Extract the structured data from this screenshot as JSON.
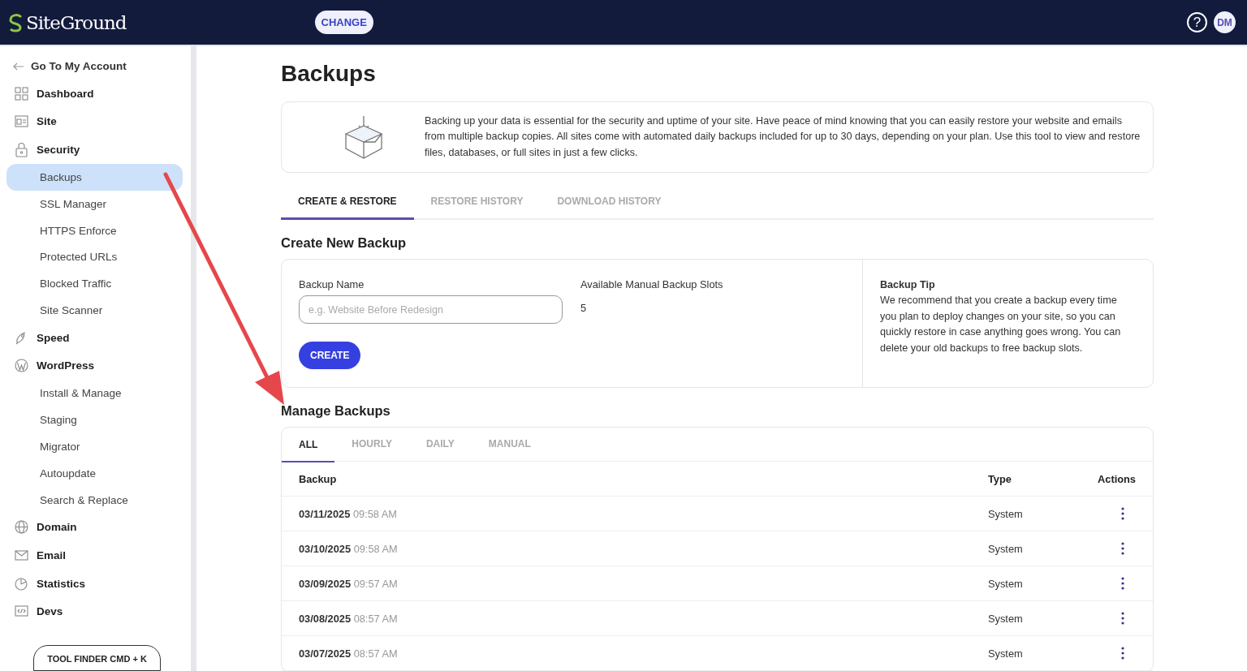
{
  "header": {
    "logo": "SiteGround",
    "change_button": "CHANGE",
    "help": "?",
    "avatar": "DM"
  },
  "sidebar": {
    "back_link": "Go To My Account",
    "items": [
      {
        "label": "Dashboard",
        "selected": false
      },
      {
        "label": "Site",
        "selected": false
      },
      {
        "label": "Security",
        "selected": false,
        "children": [
          {
            "label": "Backups",
            "selected": true
          },
          {
            "label": "SSL Manager",
            "selected": false
          },
          {
            "label": "HTTPS Enforce",
            "selected": false
          },
          {
            "label": "Protected URLs",
            "selected": false
          },
          {
            "label": "Blocked Traffic",
            "selected": false
          },
          {
            "label": "Site Scanner",
            "selected": false
          }
        ]
      },
      {
        "label": "Speed",
        "selected": false
      },
      {
        "label": "WordPress",
        "selected": false,
        "children": [
          {
            "label": "Install & Manage",
            "selected": false
          },
          {
            "label": "Staging",
            "selected": false
          },
          {
            "label": "Migrator",
            "selected": false
          },
          {
            "label": "Autoupdate",
            "selected": false
          },
          {
            "label": "Search & Replace",
            "selected": false
          }
        ]
      },
      {
        "label": "Domain",
        "selected": false
      },
      {
        "label": "Email",
        "selected": false
      },
      {
        "label": "Statistics",
        "selected": false
      },
      {
        "label": "Devs",
        "selected": false
      }
    ],
    "tool_finder": "TOOL FINDER CMD + K"
  },
  "page": {
    "title": "Backups",
    "intro": "Backing up your data is essential for the security and uptime of your site. Have peace of mind knowing that you can easily restore your website and emails from multiple backup copies. All sites come with automated daily backups included for up to 30 days, depending on your plan. Use this tool to view and restore files, databases, or full sites in just a few clicks.",
    "tabs": [
      {
        "label": "CREATE & RESTORE",
        "selected": true
      },
      {
        "label": "RESTORE HISTORY",
        "selected": false
      },
      {
        "label": "DOWNLOAD HISTORY",
        "selected": false
      }
    ],
    "create": {
      "title": "Create New Backup",
      "name_label": "Backup Name",
      "placeholder": "e.g. Website Before Redesign",
      "slots_label": "Available Manual Backup Slots",
      "slots_value": "5",
      "button": "CREATE",
      "tip_title": "Backup Tip",
      "tip_text": "We recommend that you create a backup every time you plan to deploy changes on your site, so you can quickly restore in case anything goes wrong. You can delete your old backups to free backup slots."
    },
    "manage": {
      "title": "Manage Backups",
      "tabs": [
        {
          "label": "ALL",
          "selected": true
        },
        {
          "label": "HOURLY",
          "selected": false
        },
        {
          "label": "DAILY",
          "selected": false
        },
        {
          "label": "MANUAL",
          "selected": false
        }
      ],
      "columns": [
        "Backup",
        "Type",
        "Actions"
      ],
      "rows": [
        {
          "date": "03/11/2025",
          "time": "09:58 AM",
          "type": "System"
        },
        {
          "date": "03/10/2025",
          "time": "09:58 AM",
          "type": "System"
        },
        {
          "date": "03/09/2025",
          "time": "09:57 AM",
          "type": "System"
        },
        {
          "date": "03/08/2025",
          "time": "08:57 AM",
          "type": "System"
        },
        {
          "date": "03/07/2025",
          "time": "08:57 AM",
          "type": "System"
        }
      ]
    }
  }
}
